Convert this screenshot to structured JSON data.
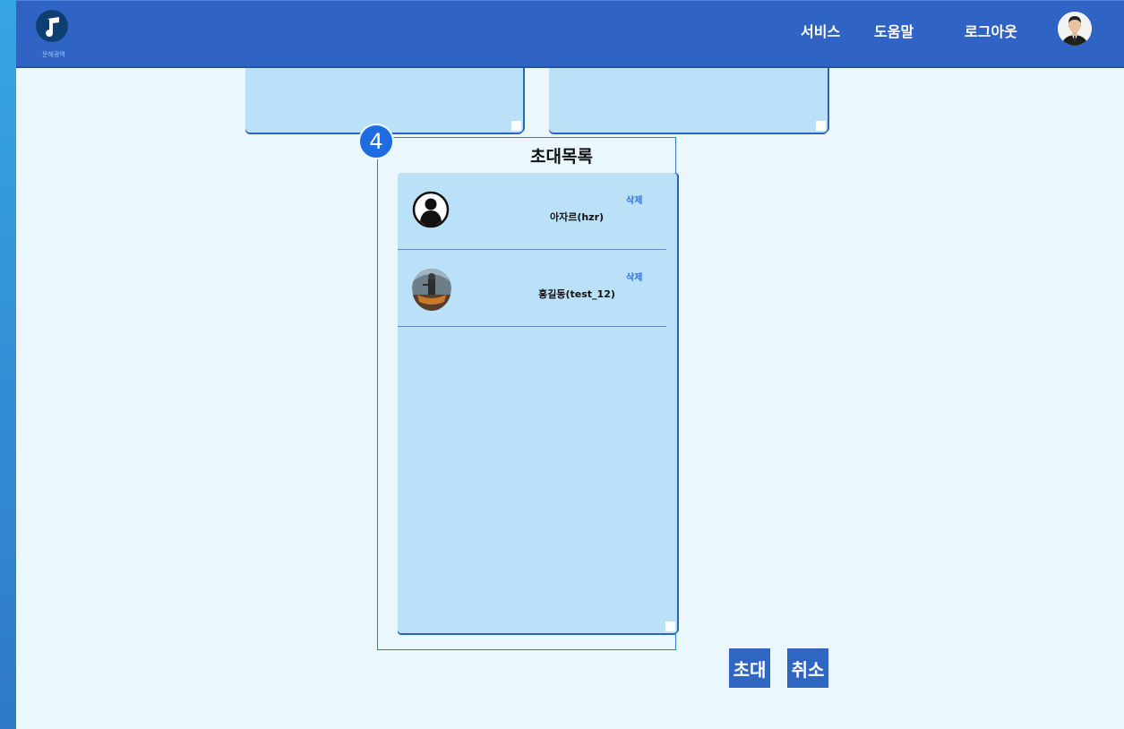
{
  "header": {
    "logo_caption": "문해광역",
    "nav": [
      "서비스",
      "도움말",
      "로그아웃"
    ]
  },
  "step_badge": "4",
  "invite_panel": {
    "title": "초대목록",
    "items": [
      {
        "name": "아자르(hzr)",
        "delete_label": "삭제",
        "avatar": "default-user-icon"
      },
      {
        "name": "홍길동(test_12)",
        "delete_label": "삭제",
        "avatar": "game-avatar"
      }
    ]
  },
  "buttons": {
    "invite": "초대",
    "cancel": "취소"
  },
  "colors": {
    "header": "#3064c4",
    "background": "#eaf8fd",
    "panel": "#bbe1f8",
    "accent": "#2d7be0"
  }
}
